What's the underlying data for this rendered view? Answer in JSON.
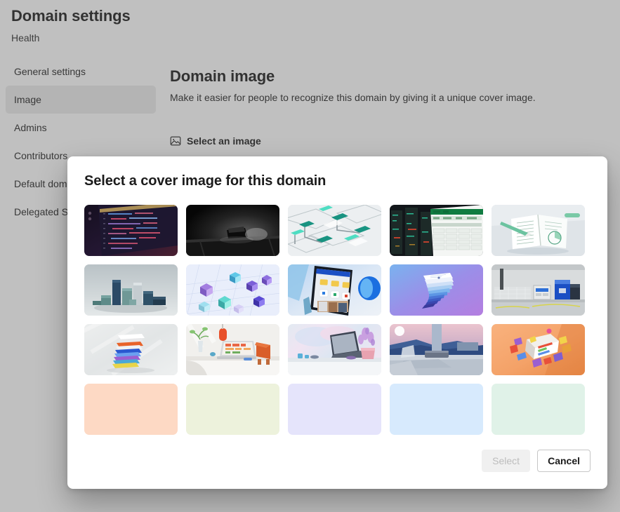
{
  "page": {
    "title": "Domain settings",
    "subtitle": "Health"
  },
  "sidebar": {
    "items": [
      {
        "label": "General settings",
        "selected": false
      },
      {
        "label": "Image",
        "selected": true
      },
      {
        "label": "Admins",
        "selected": false
      },
      {
        "label": "Contributors",
        "selected": false
      },
      {
        "label": "Default doma",
        "selected": false
      },
      {
        "label": "Delegated Se",
        "selected": false
      }
    ]
  },
  "content": {
    "title": "Domain image",
    "description": "Make it easier for people to recognize this domain by giving it a unique cover image.",
    "select_image_label": "Select an image",
    "select_image_icon": "image-icon"
  },
  "dialog": {
    "title": "Select a cover image for this domain",
    "select_button": "Select",
    "select_button_disabled": true,
    "cancel_button": "Cancel",
    "thumbnails": [
      {
        "name": "code-editor-dark",
        "kind": "photo",
        "description": "Dark code editor on monitor with red and blue syntax",
        "colors": [
          "#1a1526",
          "#2a1f3d",
          "#4a2436"
        ]
      },
      {
        "name": "laptop-dark-desk",
        "kind": "photo",
        "description": "Laptop glowing on a dark desk",
        "colors": [
          "#0a0a0a",
          "#262626",
          "#3a3a3a"
        ]
      },
      {
        "name": "abstract-teal-blocks",
        "kind": "photo",
        "description": "Abstract white and teal 3D flow diagram",
        "colors": [
          "#e9ecef",
          "#0f8f7e",
          "#35d6bc"
        ]
      },
      {
        "name": "server-room-green",
        "kind": "photo",
        "description": "Dark server room with green spreadsheet overlay",
        "colors": [
          "#141414",
          "#107c41",
          "#e8f3ec"
        ]
      },
      {
        "name": "open-notebook-green",
        "kind": "photo",
        "description": "Open notebook with pen and green accents",
        "colors": [
          "#dfe3e8",
          "#ffffff",
          "#6dbd9e"
        ]
      },
      {
        "name": "grey-teal-cubes",
        "kind": "photo",
        "description": "Grey and teal 3D blocks on a flat surface",
        "colors": [
          "#c9cfd3",
          "#3f6e74",
          "#24435e"
        ]
      },
      {
        "name": "glass-cubes-purple",
        "kind": "photo",
        "description": "Floating translucent purple and teal glass cubes",
        "colors": [
          "#e6ecfa",
          "#7a5bd6",
          "#3fc7c2"
        ]
      },
      {
        "name": "tablet-app-blue",
        "kind": "photo",
        "description": "Tablet showing an app with blue ring object",
        "colors": [
          "#cfe0f5",
          "#1055c7",
          "#e8c64a"
        ]
      },
      {
        "name": "stacked-cards-violet",
        "kind": "photo",
        "description": "Spiral of stacked cards on blue-violet gradient",
        "colors": [
          "#7fb4f0",
          "#a57ae8",
          "#ffffff"
        ]
      },
      {
        "name": "office-printer-blue",
        "kind": "photo",
        "description": "Grey office scene with blue printer equipment",
        "colors": [
          "#d8d8d8",
          "#1a56c4",
          "#9aa1a8"
        ]
      },
      {
        "name": "paper-stack-color",
        "kind": "photo",
        "description": "Fanned stack of colorful papers on grey",
        "colors": [
          "#e4e4e4",
          "#2a58d0",
          "#e8632a"
        ]
      },
      {
        "name": "desk-laptop-orange",
        "kind": "photo",
        "description": "Bright desk with laptop, plant and orange lamp",
        "colors": [
          "#f0efec",
          "#e8502a",
          "#6fae5f"
        ]
      },
      {
        "name": "laptop-lavender",
        "kind": "photo",
        "description": "Laptop on a windowsill with lavender plant",
        "colors": [
          "#dde5ef",
          "#b493d6",
          "#3c4452"
        ]
      },
      {
        "name": "lounge-sunset-blue",
        "kind": "photo",
        "description": "Render of a lounge seat at sunset by water",
        "colors": [
          "#e9c9cf",
          "#2f4e8c",
          "#8fa6c4"
        ]
      },
      {
        "name": "app-tiles-orange",
        "kind": "photo",
        "description": "Colorful app tiles on an orange background",
        "colors": [
          "#f7ab72",
          "#e88a47",
          "#8e4fc0"
        ]
      },
      {
        "name": "solid-peach",
        "kind": "solid",
        "description": "Solid peach color swatch",
        "colors": [
          "#fdd9c4"
        ]
      },
      {
        "name": "solid-light-lime",
        "kind": "solid",
        "description": "Solid light lime color swatch",
        "colors": [
          "#edf2dc"
        ]
      },
      {
        "name": "solid-lavender",
        "kind": "solid",
        "description": "Solid lavender color swatch",
        "colors": [
          "#e5e4fb"
        ]
      },
      {
        "name": "solid-light-blue",
        "kind": "solid",
        "description": "Solid light blue color swatch",
        "colors": [
          "#d7eafd"
        ]
      },
      {
        "name": "solid-mint",
        "kind": "solid",
        "description": "Solid mint color swatch",
        "colors": [
          "#e0f2e8"
        ]
      }
    ]
  }
}
